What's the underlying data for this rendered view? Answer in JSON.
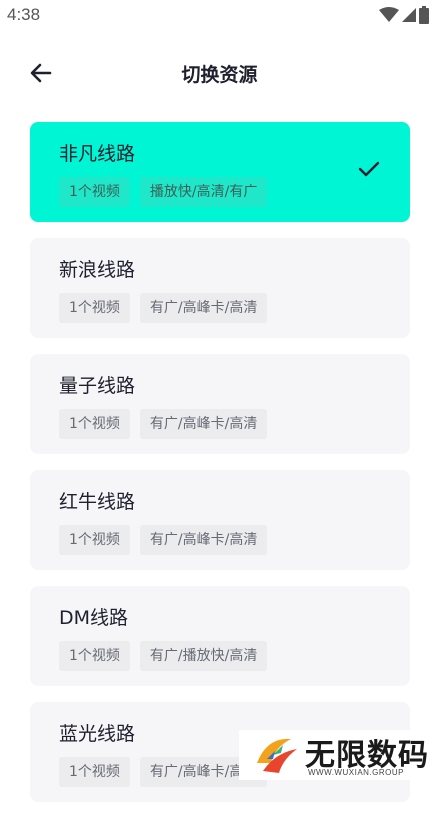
{
  "status_bar": {
    "time": "4:38"
  },
  "header": {
    "title": "切换资源"
  },
  "routes": [
    {
      "name": "非凡线路",
      "tags": [
        "1个视频",
        "播放快/高清/有广"
      ],
      "selected": true
    },
    {
      "name": "新浪线路",
      "tags": [
        "1个视频",
        "有广/高峰卡/高清"
      ],
      "selected": false
    },
    {
      "name": "量子线路",
      "tags": [
        "1个视频",
        "有广/高峰卡/高清"
      ],
      "selected": false
    },
    {
      "name": "红牛线路",
      "tags": [
        "1个视频",
        "有广/高峰卡/高清"
      ],
      "selected": false
    },
    {
      "name": "DM线路",
      "tags": [
        "1个视频",
        "有广/播放快/高清"
      ],
      "selected": false
    },
    {
      "name": "蓝光线路",
      "tags": [
        "1个视频",
        "有广/高峰卡/高清"
      ],
      "selected": false
    }
  ],
  "watermark": {
    "text": "无限数码",
    "subtext": "WWW.WUXIAN.GROUP"
  },
  "colors": {
    "accent": "#00f5d4",
    "card_bg": "#f6f6f8",
    "tag_bg": "#ececef"
  },
  "icons": {
    "back": "arrow-left-icon",
    "selected": "check-icon"
  }
}
